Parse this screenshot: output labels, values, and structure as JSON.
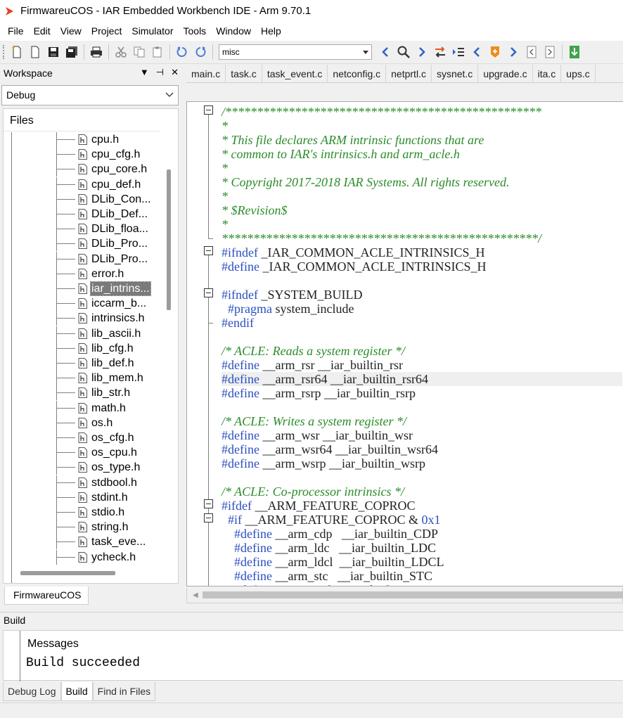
{
  "window": {
    "title": "FirmwareuCOS - IAR Embedded Workbench IDE - Arm 9.70.1"
  },
  "menu": [
    "File",
    "Edit",
    "View",
    "Project",
    "Simulator",
    "Tools",
    "Window",
    "Help"
  ],
  "toolbar": {
    "search_value": "misc"
  },
  "workspace": {
    "title": "Workspace",
    "controls": [
      "▼",
      "⊣",
      "✕"
    ],
    "configuration": "Debug",
    "files_header": "Files",
    "tab": "FirmwareuCOS",
    "files": [
      "cpu.h",
      "cpu_cfg.h",
      "cpu_core.h",
      "cpu_def.h",
      "DLib_Con...",
      "DLib_Def...",
      "DLib_floa...",
      "DLib_Pro...",
      "DLib_Pro...",
      "error.h",
      "iar_intrins...",
      "iccarm_b...",
      "intrinsics.h",
      "lib_ascii.h",
      "lib_cfg.h",
      "lib_def.h",
      "lib_mem.h",
      "lib_str.h",
      "math.h",
      "os.h",
      "os_cfg.h",
      "os_cpu.h",
      "os_type.h",
      "stdbool.h",
      "stdint.h",
      "stdio.h",
      "string.h",
      "task_eve...",
      "ycheck.h"
    ],
    "selected_file": "iar_intrins..."
  },
  "editor": {
    "tabs": [
      "main.c",
      "task.c",
      "task_event.c",
      "netconfig.c",
      "netprtl.c",
      "sysnet.c",
      "upgrade.c",
      "ita.c",
      "ups.c"
    ],
    "code": [
      "/**************************************************",
      "*",
      "* This file declares ARM intrinsic functions that are",
      "* common to IAR's intrinsics.h and arm_acle.h",
      "*",
      "* Copyright 2017-2018 IAR Systems. All rights reserved.",
      "*",
      "* $Revision$",
      "*",
      "**************************************************/",
      "#ifndef _IAR_COMMON_ACLE_INTRINSICS_H",
      "#define _IAR_COMMON_ACLE_INTRINSICS_H",
      "",
      "#ifndef _SYSTEM_BUILD",
      "  #pragma system_include",
      "#endif",
      "",
      "/* ACLE: Reads a system register */",
      "#define __arm_rsr __iar_builtin_rsr",
      "#define __arm_rsr64 __iar_builtin_rsr64",
      "#define __arm_rsrp __iar_builtin_rsrp",
      "",
      "/* ACLE: Writes a system register */",
      "#define __arm_wsr __iar_builtin_wsr",
      "#define __arm_wsr64 __iar_builtin_wsr64",
      "#define __arm_wsrp __iar_builtin_wsrp",
      "",
      "/* ACLE: Co-processor intrinsics */",
      "#ifdef __ARM_FEATURE_COPROC",
      "  #if __ARM_FEATURE_COPROC & 0x1",
      "    #define __arm_cdp   __iar_builtin_CDP",
      "    #define __arm_ldc   __iar_builtin_LDC",
      "    #define __arm_ldcl  __iar_builtin_LDCL",
      "    #define __arm_stc   __iar_builtin_STC",
      "    #define __arm_stcl  __iar_builtin_STCL"
    ]
  },
  "build": {
    "title": "Build",
    "messages_label": "Messages",
    "result": "Build succeeded",
    "tabs": [
      "Debug Log",
      "Build",
      "Find in Files"
    ]
  },
  "colors": {
    "comment": "#2a8c2a",
    "keyword": "#2b4fc0",
    "accent": "#e8401c"
  }
}
